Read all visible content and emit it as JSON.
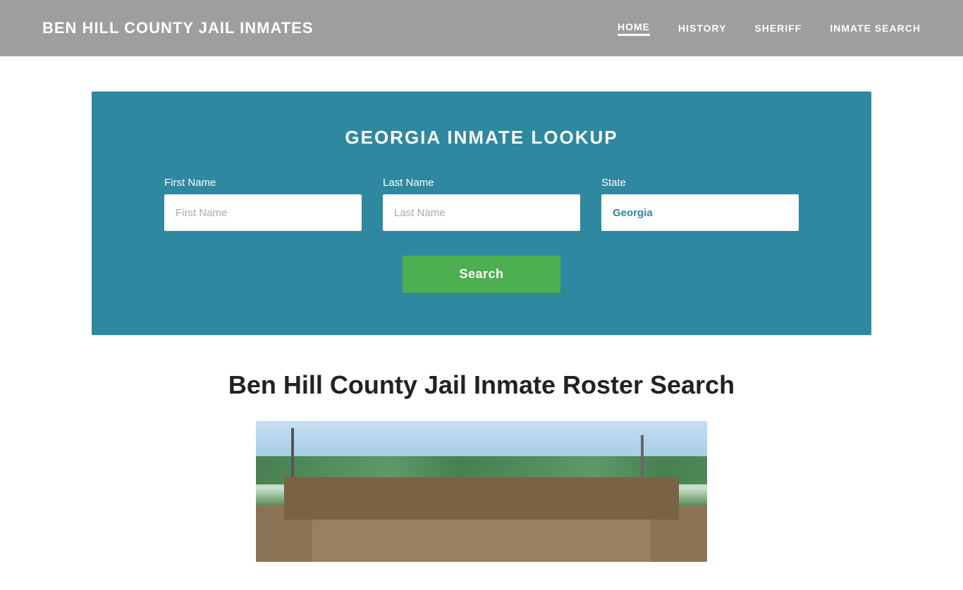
{
  "header": {
    "site_title": "BEN HILL COUNTY JAIL INMATES",
    "nav": {
      "home": "HOME",
      "history": "HISTORY",
      "sheriff": "SHERIFF",
      "inmate_search": "INMATE SEARCH"
    }
  },
  "search_section": {
    "title": "GEORGIA INMATE LOOKUP",
    "fields": {
      "first_name_label": "First Name",
      "first_name_placeholder": "First Name",
      "last_name_label": "Last Name",
      "last_name_placeholder": "Last Name",
      "state_label": "State",
      "state_value": "Georgia"
    },
    "search_button": "Search"
  },
  "content": {
    "title": "Ben Hill County Jail Inmate Roster Search"
  },
  "colors": {
    "header_bg": "#9e9e9e",
    "search_bg": "#2e88a0",
    "search_btn": "#4caf50",
    "text_white": "#ffffff",
    "text_dark": "#222222"
  }
}
